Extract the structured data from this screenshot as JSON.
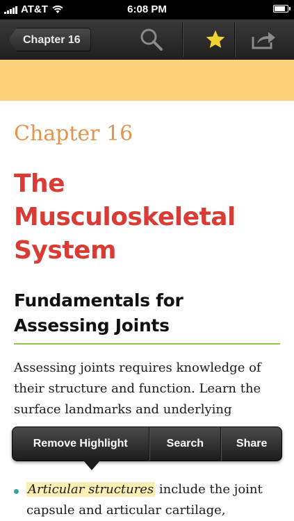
{
  "status_bar": {
    "carrier": "AT&T",
    "time": "6:08 PM",
    "battery_level": 0.9
  },
  "nav_bar": {
    "back_label": "Chapter 16",
    "icons": {
      "search": "search-icon",
      "bookmark": "star-icon",
      "share": "share-icon"
    },
    "accent_star_color": "#f2d22e"
  },
  "content": {
    "chapter_label": "Chapter 16",
    "chapter_title": "The Musculoskeletal System",
    "section_title": "Fundamentals for Assessing Joints",
    "paragraph": "Assessing joints requires knowledge of their structure and function. Learn the surface landmarks and underlying",
    "bullet": {
      "highlighted": "Articular structures",
      "rest": " include the joint capsule and articular cartilage,"
    }
  },
  "popup_menu": {
    "items": [
      "Remove Highlight",
      "Search",
      "Share"
    ]
  },
  "colors": {
    "banner": "#fcd37b",
    "chapter_label": "#e2934c",
    "chapter_title": "#d93b35",
    "rule": "#8fc34a",
    "bullet": "#36a59c",
    "highlight": "#fbefb3"
  }
}
